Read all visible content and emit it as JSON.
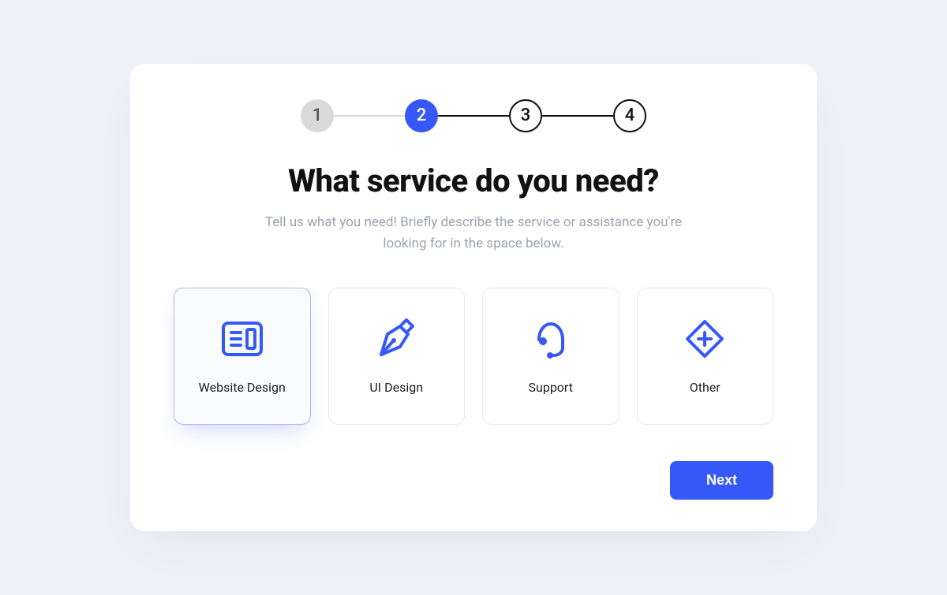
{
  "stepper": {
    "steps": [
      "1",
      "2",
      "3",
      "4"
    ],
    "current_index": 1
  },
  "heading": "What service do you need?",
  "subheading": "Tell us what you need! Briefly describe the service or assistance you're looking for in the space below.",
  "options": [
    {
      "id": "website-design",
      "label": "Website Design",
      "icon": "layout-icon",
      "selected": true
    },
    {
      "id": "ui-design",
      "label": "UI Design",
      "icon": "pen-nib-icon",
      "selected": false
    },
    {
      "id": "support",
      "label": "Support",
      "icon": "headset-icon",
      "selected": false
    },
    {
      "id": "other",
      "label": "Other",
      "icon": "diamond-plus-icon",
      "selected": false
    }
  ],
  "footer": {
    "next_label": "Next"
  },
  "colors": {
    "primary": "#3758f9",
    "muted": "#9ca3af",
    "border": "#e5e7eb"
  }
}
